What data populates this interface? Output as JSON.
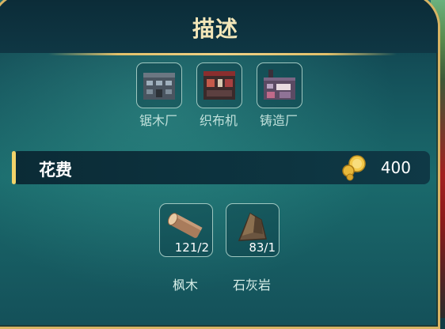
{
  "title": "描述",
  "buildings": [
    {
      "label": "锯木厂",
      "icon": "sawmill-icon"
    },
    {
      "label": "织布机",
      "icon": "loom-icon"
    },
    {
      "label": "铸造厂",
      "icon": "foundry-icon"
    }
  ],
  "cost": {
    "label": "花费",
    "value": "400",
    "icon": "gold-coin-icon"
  },
  "materials": [
    {
      "label": "枫木",
      "count": "121/2",
      "icon": "maple-log-icon"
    },
    {
      "label": "石灰岩",
      "count": "83/1",
      "icon": "limestone-icon"
    }
  ],
  "colors": {
    "gold": "#d8b463",
    "panel": "#14515a",
    "accent": "#f2d36a"
  }
}
